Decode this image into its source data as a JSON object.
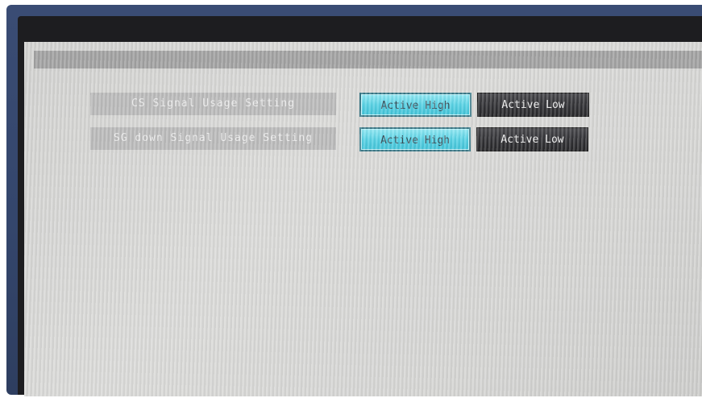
{
  "settings": {
    "rows": [
      {
        "label": "CS Signal Usage Setting",
        "options": [
          "Active High",
          "Active Low"
        ],
        "selected": "Active High"
      },
      {
        "label": "SG down Signal Usage Setting",
        "options": [
          "Active High",
          "Active Low"
        ],
        "selected": "Active High"
      }
    ]
  },
  "colors": {
    "selected_button": "#4ccfe3",
    "unselected_button": "#222226",
    "label_background": "#b6b6b6",
    "panel_background": "#d4d4d2"
  }
}
